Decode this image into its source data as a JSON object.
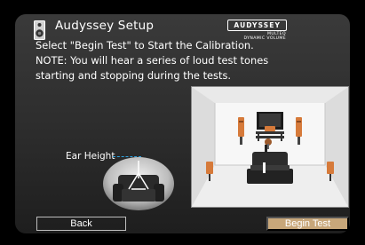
{
  "header": {
    "title": "Audyssey Setup",
    "icon": "speaker-icon"
  },
  "logo": {
    "brand": "AUDYSSEY",
    "sub1": "MULTEQ",
    "sub2": "DYNAMIC VOLUME"
  },
  "instructions": {
    "line1": "Select \"Begin Test\" to Start the Calibration.",
    "line2": "NOTE: You will hear a series of loud test tones",
    "line3": "starting and stopping during the tests."
  },
  "ear_height": {
    "label": "Ear Height"
  },
  "buttons": {
    "back": "Back",
    "begin": "Begin Test"
  },
  "colors": {
    "accent_button": "#c8a77a",
    "speaker_orange": "#d67a3a",
    "ear_line": "#2fa2e0"
  }
}
